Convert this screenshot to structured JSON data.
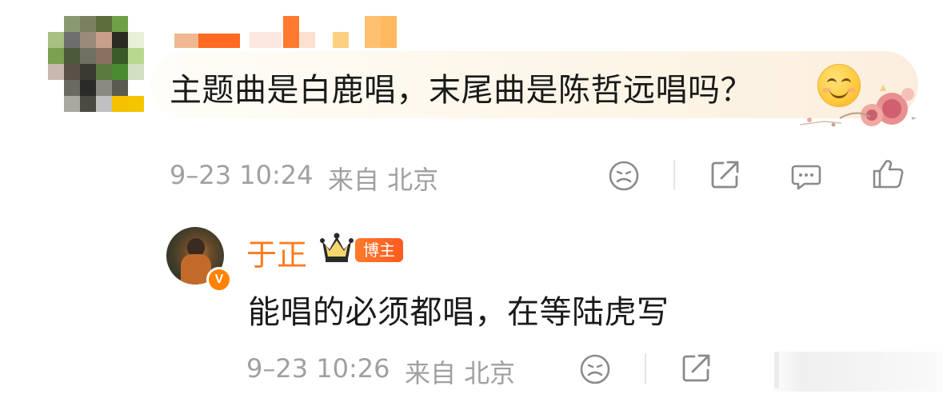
{
  "comment": {
    "text": "主题曲是白鹿唱，末尾曲是陈哲远唱吗？",
    "emoji_icon": "smiley-face-icon",
    "time": "9–23 10:24",
    "source": "来自 北京",
    "actions": [
      "dislike-icon",
      "share-icon",
      "comment-icon",
      "like-icon"
    ]
  },
  "reply": {
    "author": "于正",
    "verified_badge": "V",
    "host_badge": "博主",
    "text": "能唱的必须都唱，在等陆虎写",
    "time": "9–23 10:26",
    "source": "来自 北京",
    "actions": [
      "dislike-icon",
      "share-icon"
    ]
  },
  "colors": {
    "accent_orange": "#ff7a1a",
    "meta_gray": "#a0a0a0",
    "text_dark": "#1a1a1a"
  }
}
